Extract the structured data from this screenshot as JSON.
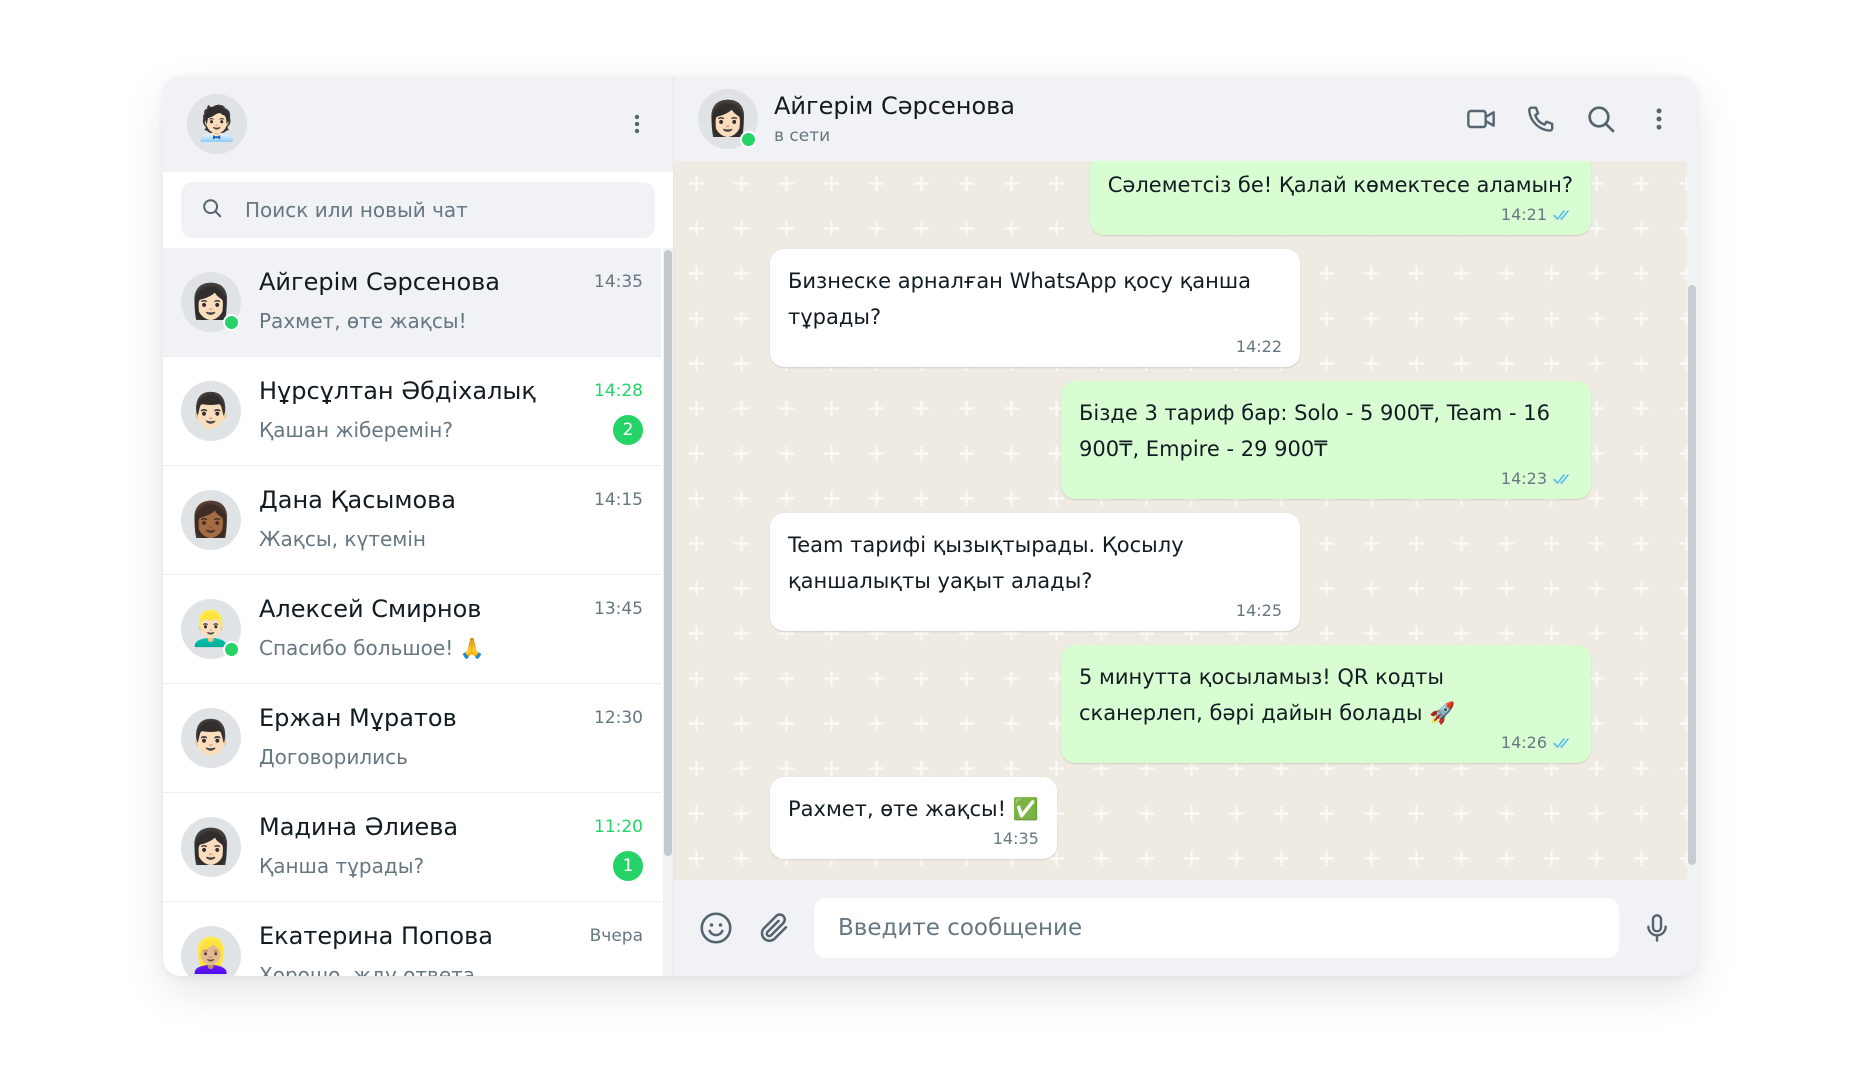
{
  "me": {
    "avatar": "🧑🏻‍💼"
  },
  "search": {
    "placeholder": "Поиск или новый чат"
  },
  "chats": [
    {
      "avatar": "👩🏻",
      "name": "Айгерім Сәрсенова",
      "time": "14:35",
      "preview": "Рахмет, өте жақсы!",
      "online": true,
      "active": true,
      "unread": ""
    },
    {
      "avatar": "👨🏻",
      "name": "Нұрсұлтан Әбдіхалық",
      "time": "14:28",
      "preview": "Қашан жіберемін?",
      "online": false,
      "active": false,
      "unread": "2"
    },
    {
      "avatar": "👩🏾",
      "name": "Дана Қасымова",
      "time": "14:15",
      "preview": "Жақсы, күтемін",
      "online": false,
      "active": false,
      "unread": ""
    },
    {
      "avatar": "👱🏻‍♂️",
      "name": "Алексей Смирнов",
      "time": "13:45",
      "preview": "Спасибо большое! 🙏",
      "online": true,
      "active": false,
      "unread": ""
    },
    {
      "avatar": "👨🏻",
      "name": "Ержан Мұратов",
      "time": "12:30",
      "preview": "Договорились",
      "online": false,
      "active": false,
      "unread": ""
    },
    {
      "avatar": "👩🏻",
      "name": "Мадина Әлиева",
      "time": "11:20",
      "preview": "Қанша тұрады?",
      "online": false,
      "active": false,
      "unread": "1"
    },
    {
      "avatar": "👱🏼‍♀️",
      "name": "Екатерина Попова",
      "time": "Вчера",
      "preview": "Хорошо, жду ответа",
      "online": false,
      "active": false,
      "unread": ""
    }
  ],
  "contact": {
    "avatar": "👩🏻",
    "name": "Айгерім Сәрсенова",
    "status": "в сети"
  },
  "messages": [
    {
      "dir": "out",
      "text": "Сәлеметсіз бе! Қалай көмектесе аламын?",
      "time": "14:21",
      "read": true
    },
    {
      "dir": "in",
      "text": "Бизнеске арналған WhatsApp қосу қанша тұрады?",
      "time": "14:22"
    },
    {
      "dir": "out",
      "text": "Бізде 3 тариф бар: Solo - 5 900₸, Team - 16 900₸, Empire - 29 900₸",
      "time": "14:23",
      "read": true
    },
    {
      "dir": "in",
      "text": "Team тарифі қызықтырады. Қосылу қаншалықты уақыт алады?",
      "time": "14:25"
    },
    {
      "dir": "out",
      "text": "5 минутта қосыламыз! QR кодты сканерлеп, бәрі дайын болады 🚀",
      "time": "14:26",
      "read": true
    },
    {
      "dir": "in",
      "text": "Рахмет, өте жақсы! ✅",
      "time": "14:35"
    }
  ],
  "composer": {
    "placeholder": "Введите сообщение"
  },
  "colors": {
    "accent": "#25d366",
    "outgoing_bubble": "#d9fdd3",
    "incoming_bubble": "#ffffff",
    "chat_bg": "#efeae2",
    "read_ticks": "#53bdeb"
  }
}
